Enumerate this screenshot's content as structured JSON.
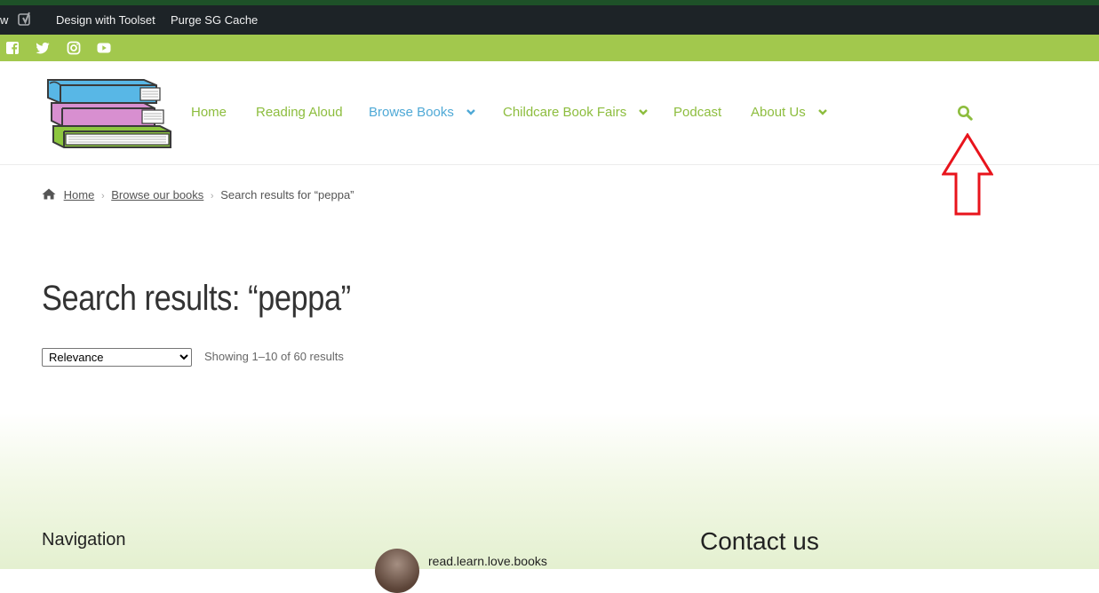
{
  "admin_bar": {
    "fragment": "w",
    "items": [
      "Design with Toolset",
      "Purge SG Cache"
    ]
  },
  "social": [
    "facebook-icon",
    "twitter-icon",
    "instagram-icon",
    "youtube-icon"
  ],
  "nav": {
    "items": [
      {
        "label": "Home",
        "dropdown": false
      },
      {
        "label": "Reading Aloud",
        "dropdown": false
      },
      {
        "label": "Browse Books",
        "dropdown": true,
        "active": true
      },
      {
        "label": "Childcare Book Fairs",
        "dropdown": true
      },
      {
        "label": "Podcast",
        "dropdown": false
      },
      {
        "label": "About Us",
        "dropdown": true
      }
    ]
  },
  "breadcrumb": {
    "home": "Home",
    "browse": "Browse our books",
    "current": "Search results for “peppa”"
  },
  "page": {
    "title": "Search results: “peppa”",
    "sort_selected": "Relevance",
    "result_count": "Showing 1–10 of 60 results"
  },
  "footer": {
    "navigation_title": "Navigation",
    "instagram_handle": "read.learn.love.books",
    "contact_title": "Contact us"
  },
  "colors": {
    "admin_bg": "#1d2327",
    "brand_green": "#a2c84d",
    "nav_green": "#8dbd3e",
    "nav_active_blue": "#4fa9d6",
    "annotation_red": "#e8141c"
  }
}
